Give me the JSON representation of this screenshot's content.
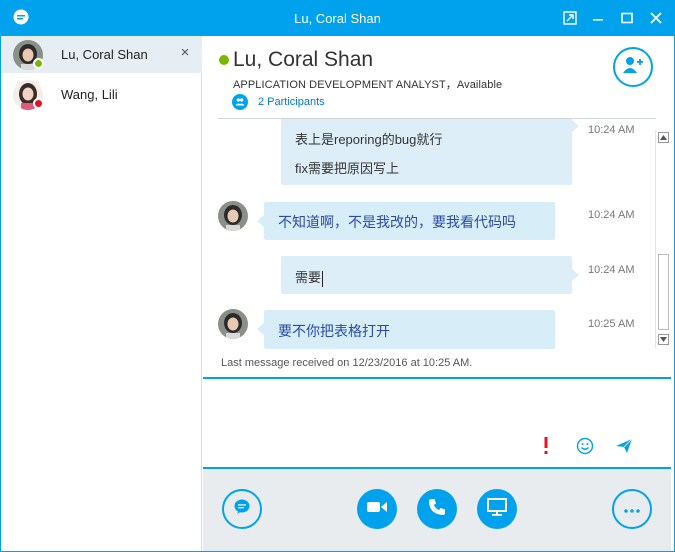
{
  "window": {
    "title": "Lu, Coral Shan"
  },
  "colors": {
    "accent": "#00a2ed",
    "available": "#7ab800",
    "busy": "#e81123",
    "bubble": "#d7eef9",
    "bubble_text_blue": "#2a4aa8"
  },
  "sidebar": {
    "conversations": [
      {
        "name": "Lu, Coral Shan",
        "presence": "available",
        "active": true,
        "close_label": "×"
      },
      {
        "name": "Wang, Lili",
        "presence": "busy",
        "active": false
      }
    ]
  },
  "header": {
    "name": "Lu, Coral Shan",
    "status": "APPLICATION DEVELOPMENT ANALYST，Available",
    "participants_label": "2 Participants",
    "add_person_icon": "add-person-icon"
  },
  "messages": [
    {
      "sender": "me",
      "lines": [
        "表上是reporing的bug就行",
        "fix需要把原因写上"
      ],
      "time": "10:24 AM"
    },
    {
      "sender": "Lu, Coral Shan",
      "lines": [
        "不知道啊，不是我改的，要我看代码吗"
      ],
      "time": "10:24 AM"
    },
    {
      "sender": "me",
      "lines": [
        "需要"
      ],
      "time": "10:24 AM"
    },
    {
      "sender": "Lu, Coral Shan",
      "lines": [
        "要不你把表格打开"
      ],
      "time": "10:25 AM"
    }
  ],
  "last_message_note": "Last message received on 12/23/2016 at 10:25 AM.",
  "compose": {
    "value": "",
    "icons": [
      "importance-icon",
      "emoticon-icon",
      "send-icon"
    ]
  },
  "bottom_bar": {
    "buttons": [
      "chat-icon",
      "video-icon",
      "call-icon",
      "screen-share-icon",
      "more-options-icon"
    ]
  }
}
